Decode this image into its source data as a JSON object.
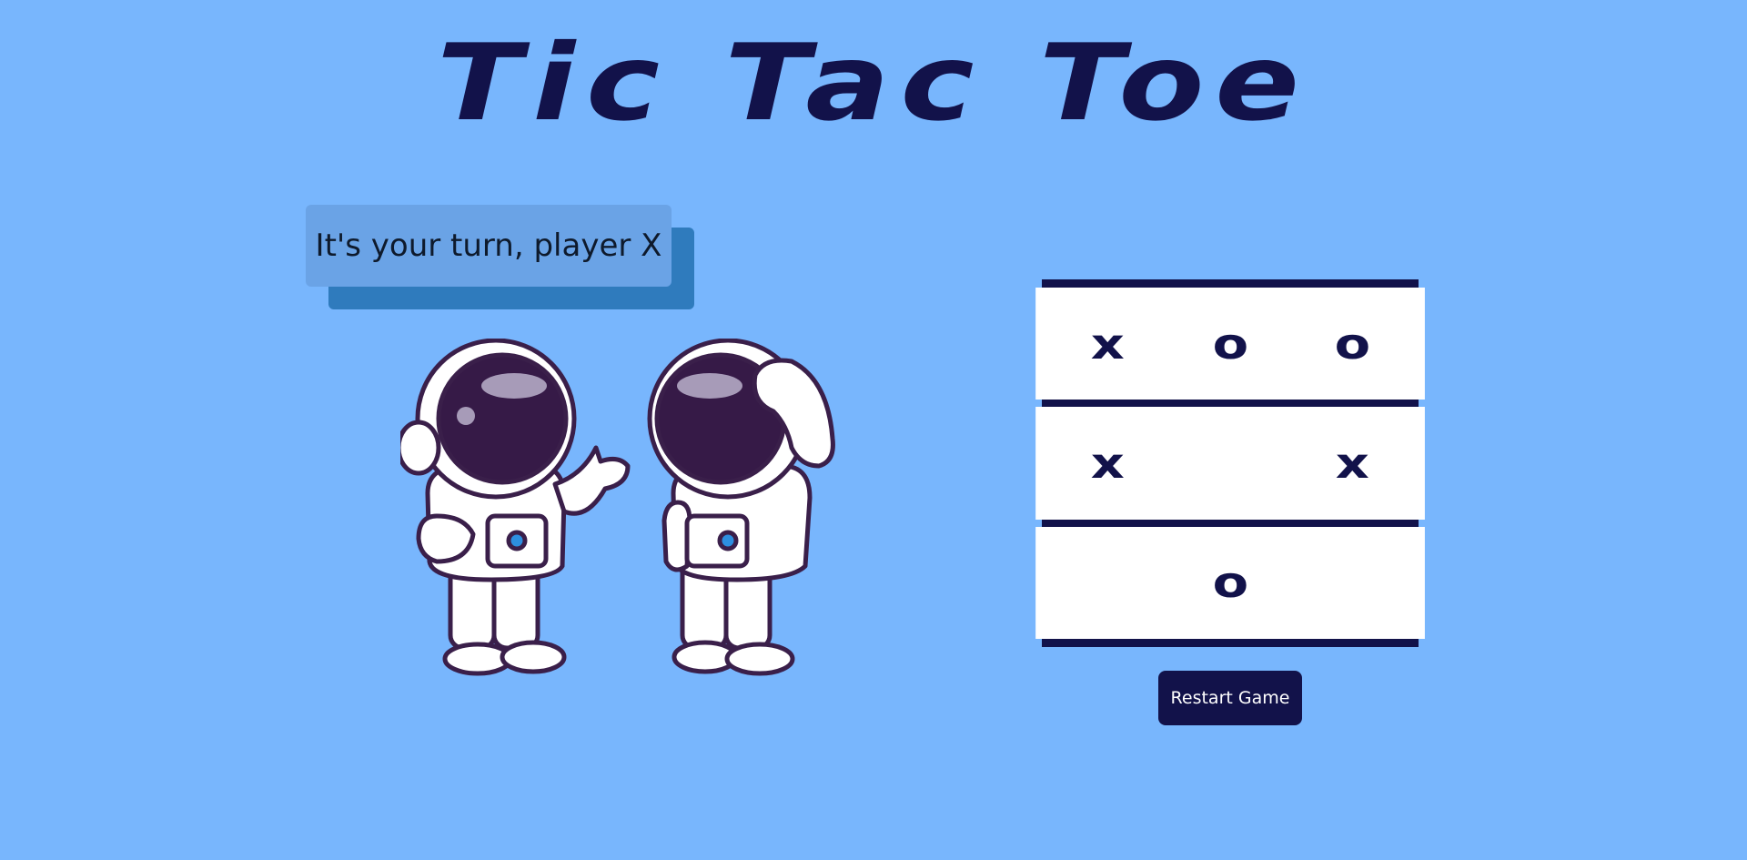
{
  "page": {
    "title": "Tic Tac Toe"
  },
  "status": {
    "message": "It's your turn, player X"
  },
  "board": {
    "cells": [
      "x",
      "o",
      "o",
      "x",
      "",
      "x",
      "",
      "o",
      ""
    ]
  },
  "controls": {
    "restart_label": "Restart Game"
  },
  "colors": {
    "background": "#78b6fd",
    "accent": "#12124a",
    "status_box": "#6aa3e6",
    "status_shadow": "#2f7bbd",
    "cell": "#ffffff"
  },
  "illustration": {
    "icon": "two-astronauts-illustration"
  }
}
